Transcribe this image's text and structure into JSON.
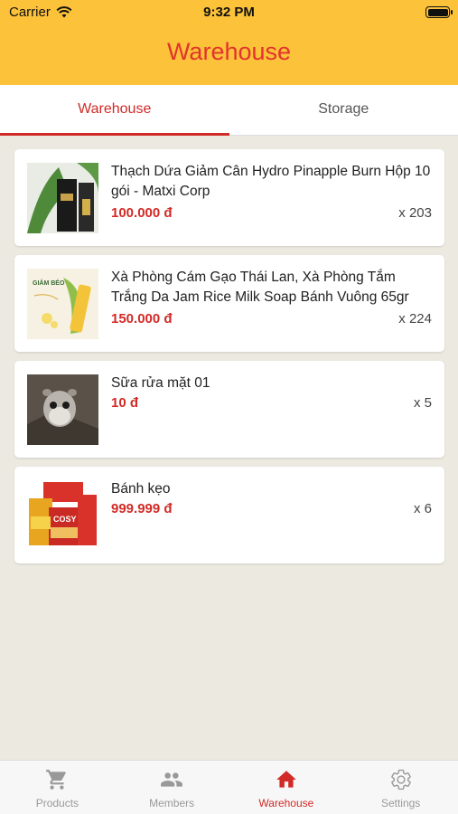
{
  "status_bar": {
    "carrier": "Carrier",
    "time": "9:32 PM"
  },
  "header": {
    "title": "Warehouse"
  },
  "tabs": [
    {
      "label": "Warehouse",
      "active": true
    },
    {
      "label": "Storage",
      "active": false
    }
  ],
  "items": [
    {
      "name": "Thạch Dứa Giảm Cân Hydro Pinapple Burn Hộp 10 gói - Matxi Corp",
      "price": "100.000 đ",
      "quantity": "x 203"
    },
    {
      "name": "Xà Phòng Cám Gạo Thái Lan, Xà Phòng Tắm Trắng Da Jam Rice Milk Soap Bánh Vuông 65gr",
      "price": "150.000 đ",
      "quantity": "x 224",
      "thumb_text": "GIẢM BÉO"
    },
    {
      "name": "Sữa rửa mặt 01",
      "price": "10 đ",
      "quantity": "x 5"
    },
    {
      "name": "Bánh kẹo",
      "price": "999.999 đ",
      "quantity": "x 6",
      "thumb_text": "COSY"
    }
  ],
  "bottom_nav": [
    {
      "label": "Products",
      "icon": "cart-icon",
      "active": false
    },
    {
      "label": "Members",
      "icon": "people-icon",
      "active": false
    },
    {
      "label": "Warehouse",
      "icon": "home-icon",
      "active": true
    },
    {
      "label": "Settings",
      "icon": "gear-icon",
      "active": false
    }
  ],
  "colors": {
    "header_bg": "#fbc23a",
    "accent": "#d22a26",
    "page_bg": "#eceae0"
  }
}
